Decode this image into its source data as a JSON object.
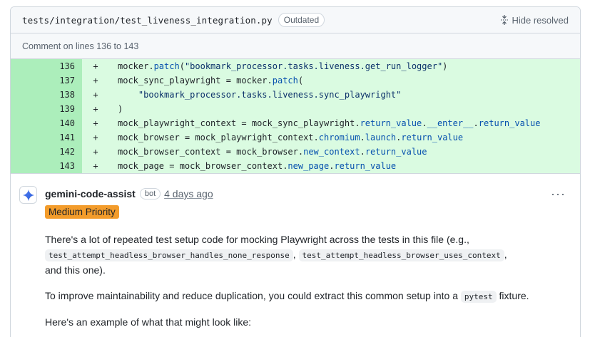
{
  "file": {
    "path": "tests/integration/test_liveness_integration.py",
    "badge": "Outdated",
    "hide_resolved": "Hide resolved"
  },
  "comment_range": "Comment on lines 136 to 143",
  "diff": {
    "sign": "+",
    "lines": [
      {
        "num": "136",
        "parts": [
          [
            "p",
            "mocker."
          ],
          [
            "a",
            "patch"
          ],
          [
            "p",
            "("
          ],
          [
            "s",
            "\"bookmark_processor.tasks.liveness.get_run_logger\""
          ],
          [
            "p",
            ")"
          ]
        ]
      },
      {
        "num": "137",
        "parts": [
          [
            "p",
            "mock_sync_playwright = mocker."
          ],
          [
            "a",
            "patch"
          ],
          [
            "p",
            "("
          ]
        ]
      },
      {
        "num": "138",
        "parts": [
          [
            "p",
            "    "
          ],
          [
            "s",
            "\"bookmark_processor.tasks.liveness.sync_playwright\""
          ]
        ]
      },
      {
        "num": "139",
        "parts": [
          [
            "p",
            ")"
          ]
        ]
      },
      {
        "num": "140",
        "parts": [
          [
            "p",
            "mock_playwright_context = mock_sync_playwright."
          ],
          [
            "a",
            "return_value"
          ],
          [
            "p",
            "."
          ],
          [
            "a",
            "__enter__"
          ],
          [
            "p",
            "."
          ],
          [
            "a",
            "return_value"
          ]
        ]
      },
      {
        "num": "141",
        "parts": [
          [
            "p",
            "mock_browser = mock_playwright_context."
          ],
          [
            "a",
            "chromium"
          ],
          [
            "p",
            "."
          ],
          [
            "a",
            "launch"
          ],
          [
            "p",
            "."
          ],
          [
            "a",
            "return_value"
          ]
        ]
      },
      {
        "num": "142",
        "parts": [
          [
            "p",
            "mock_browser_context = mock_browser."
          ],
          [
            "a",
            "new_context"
          ],
          [
            "p",
            "."
          ],
          [
            "a",
            "return_value"
          ]
        ]
      },
      {
        "num": "143",
        "parts": [
          [
            "p",
            "mock_page = mock_browser_context."
          ],
          [
            "a",
            "new_page"
          ],
          [
            "p",
            "."
          ],
          [
            "a",
            "return_value"
          ]
        ]
      }
    ]
  },
  "comment": {
    "author": "gemini-code-assist",
    "bot_label": "bot",
    "time": "4 days ago",
    "priority": "Medium Priority",
    "p1_a": "There's a lot of repeated test setup code for mocking Playwright across the tests in this file (e.g.,",
    "code1": "test_attempt_headless_browser_handles_none_response",
    "sep": ",",
    "code2": "test_attempt_headless_browser_uses_context",
    "p1_b": ",",
    "p1_c": "and this one).",
    "p2_a": "To improve maintainability and reduce duplication, you could extract this common setup into a",
    "code3": "pytest",
    "p2_b": "fixture.",
    "p3": "Here's an example of what that might look like:"
  },
  "colors": {
    "added_bg": "#dafbe1",
    "added_num_bg": "#aceebb",
    "priority_bg": "#f39c2b",
    "attr": "#0550ae",
    "string": "#0a3069"
  }
}
